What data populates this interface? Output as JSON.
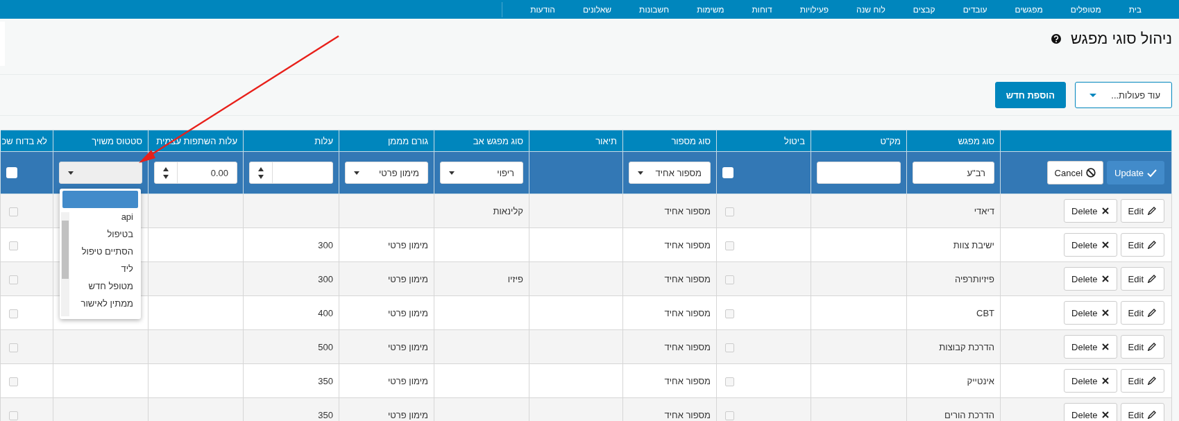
{
  "nav": {
    "items": [
      "בית",
      "מטופלים",
      "מפגשים",
      "עובדים",
      "קבצים",
      "לוח שנה",
      "פעילויות",
      "דוחות",
      "משימות",
      "חשבונות",
      "שאלונים",
      "הודעות"
    ]
  },
  "page": {
    "title": "ניהול סוגי מפגש"
  },
  "toolbar": {
    "more_actions": "עוד פעולות...",
    "add_new": "הוספת חדש"
  },
  "table": {
    "columns": [
      "סוג מפגש",
      "מק\"ט",
      "ביטול",
      "סוג מספור",
      "תיאור",
      "סוג מפגש אב",
      "גורם מממן",
      "עלות",
      "עלות השתפות עצמית",
      "סטטוס משויך",
      "לא בדוח שכ"
    ],
    "edit_row": {
      "update_label": "Update",
      "cancel_label": "Cancel",
      "name_value": "רב\"ע",
      "cancelled": false,
      "numbering_value": "מספור אחיד",
      "parent_value": "ריפוי",
      "payer_value": "מימון פרטי",
      "copay_value": "0.00",
      "status": {
        "open": true,
        "options": [
          {
            "selected": true
          },
          {
            "label": "api",
            "selected": false
          },
          {
            "label": "בטיפול",
            "selected": false
          },
          {
            "label": "הסתיים טיפול",
            "selected": false
          },
          {
            "label": "ליד",
            "selected": false
          },
          {
            "label": "מטופל חדש",
            "selected": false
          },
          {
            "label": "ממתין לאישור",
            "selected": false
          }
        ]
      },
      "excluded": false
    },
    "rows": [
      {
        "edit_label": "Edit",
        "delete_label": "Delete",
        "name": "דיאדי",
        "cancelled": false,
        "numbering": "מספור אחיד",
        "parent": "קלינאות",
        "excluded": false
      },
      {
        "edit_label": "Edit",
        "delete_label": "Delete",
        "name": "ישיבת צוות",
        "cancelled": false,
        "numbering": "מספור אחיד",
        "payer": "מימון פרטי",
        "cost": "300",
        "excluded": false
      },
      {
        "edit_label": "Edit",
        "delete_label": "Delete",
        "name": "פיזיותרפיה",
        "cancelled": false,
        "numbering": "מספור אחיד",
        "parent": "פיזיו",
        "payer": "מימון פרטי",
        "cost": "300",
        "excluded": false
      },
      {
        "edit_label": "Edit",
        "delete_label": "Delete",
        "name": "CBT",
        "cancelled": false,
        "numbering": "מספור אחיד",
        "payer": "מימון פרטי",
        "cost": "400",
        "excluded": false
      },
      {
        "edit_label": "Edit",
        "delete_label": "Delete",
        "name": "הדרכת קבוצות",
        "cancelled": false,
        "numbering": "מספור אחיד",
        "payer": "מימון פרטי",
        "cost": "500",
        "excluded": false
      },
      {
        "edit_label": "Edit",
        "delete_label": "Delete",
        "name": "אינטייק",
        "cancelled": false,
        "numbering": "מספור אחיד",
        "payer": "מימון פרטי",
        "cost": "350",
        "excluded": false
      },
      {
        "edit_label": "Edit",
        "delete_label": "Delete",
        "name": "הדרכת הורים",
        "cancelled": false,
        "numbering": "מספור אחיד",
        "payer": "מימון פרטי",
        "cost": "350",
        "excluded": false
      }
    ]
  }
}
